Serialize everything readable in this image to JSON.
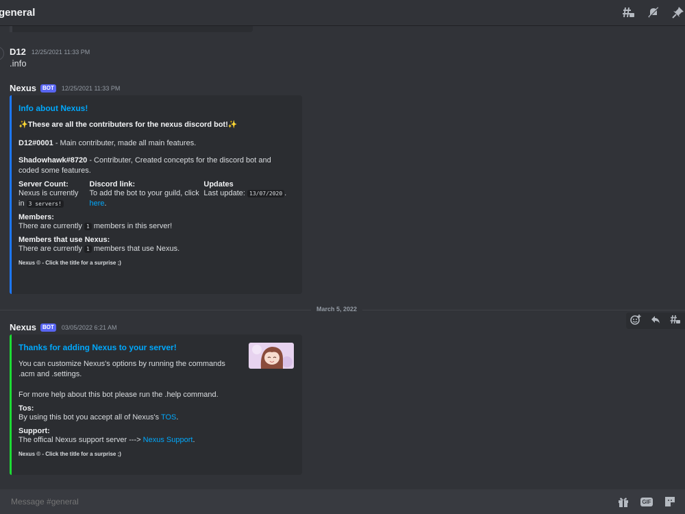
{
  "header": {
    "channel": "general"
  },
  "messages": [
    {
      "user": "D12",
      "timestamp": "12/25/2021 11:33 PM",
      "text": ".info"
    },
    {
      "user": "Nexus",
      "bot_tag": "BOT",
      "timestamp": "12/25/2021 11:33 PM",
      "embed": {
        "color": "#1d78ff",
        "title": "Info about Nexus!",
        "intro": "✨These are all the contributers for the nexus discord bot!✨",
        "contributor1_name": "D12#0001",
        "contributor1_desc": " - Main contributer, made all main features.",
        "contributor2_name": "Shadowhawk#8720",
        "contributor2_desc": " - Contributer, Created concepts for the discord bot and coded some features.",
        "server_count_label": "Server Count:",
        "server_count_text": "Nexus is currently in",
        "server_count_code": "3 servers!",
        "discord_link_label": "Discord link:",
        "discord_link_text": "To add the bot to your guild, click",
        "discord_link_link": "here",
        "discord_link_after": ".",
        "updates_label": "Updates",
        "updates_text": "Last update:",
        "updates_code": "13/07/2020",
        "updates_after": ".",
        "members_label": "Members:",
        "members_before": "There are currently ",
        "members_code": "1",
        "members_after": " members in this server!",
        "members_nexus_label": "Members that use Nexus:",
        "members_nexus_before": "There are currently ",
        "members_nexus_code": "1",
        "members_nexus_after": " members that use Nexus.",
        "footer": "Nexus © - Click the title for a surprise ;)"
      }
    },
    {
      "date_divider": "March 5, 2022"
    },
    {
      "user": "Nexus",
      "bot_tag": "BOT",
      "timestamp": "03/05/2022 6:21 AM",
      "embed": {
        "color": "#1ddc34",
        "title": "Thanks for adding Nexus to your server!",
        "desc1": "You can customize Nexus's options by running the commands .acm and .settings.",
        "desc2": "For more help about this bot please run the .help command.",
        "tos_label": "Tos:",
        "tos_before": "By using this bot you accept all of Nexus's ",
        "tos_link": "TOS",
        "tos_after": ".",
        "support_label": "Support:",
        "support_before": "The offical Nexus support server ---> ",
        "support_link": "Nexus Support",
        "support_after": ".",
        "footer": "Nexus © - Click the title for a surprise ;)"
      }
    }
  ],
  "composer": {
    "placeholder": "Message #general",
    "gif_label": "GIF"
  },
  "icons": {
    "top": [
      "threads-icon",
      "mute-bell-icon",
      "pin-icon"
    ],
    "hover": [
      "add-reaction-icon",
      "reply-icon",
      "create-thread-icon"
    ],
    "composer": [
      "gift-icon",
      "gif-icon",
      "sticker-icon"
    ]
  },
  "colors": {
    "background": "#313338",
    "embed_bg": "#2b2d31",
    "link": "#00a8fc",
    "bot_tag": "#5865f2"
  }
}
